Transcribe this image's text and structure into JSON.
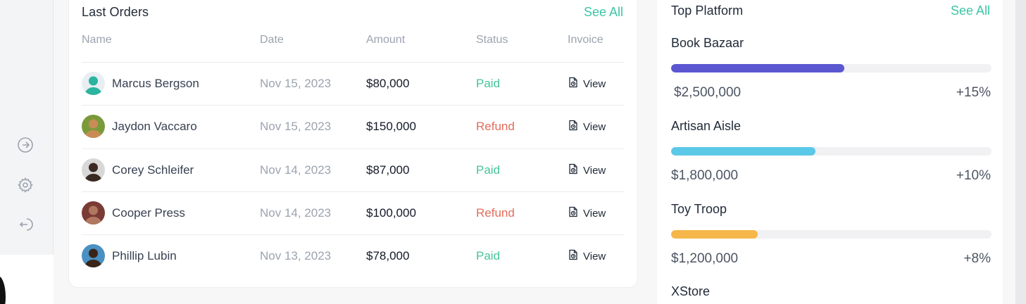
{
  "sidebar": {
    "icons": [
      {
        "name": "arrow-right-circle-icon"
      },
      {
        "name": "gear-icon"
      },
      {
        "name": "logout-icon"
      }
    ]
  },
  "orders": {
    "title": "Last Orders",
    "see_all": "See All",
    "columns": [
      "Name",
      "Date",
      "Amount",
      "Status",
      "Invoice"
    ],
    "rows": [
      {
        "name": "Marcus Bergson",
        "date": "Nov 15, 2023",
        "amount": "$80,000",
        "status": "Paid",
        "invoice": "View",
        "avatar_bg": "#e8eef2",
        "avatar_fg": "#2bb4a0"
      },
      {
        "name": "Jaydon Vaccaro",
        "date": "Nov 15, 2023",
        "amount": "$150,000",
        "status": "Refund",
        "invoice": "View",
        "avatar_bg": "#7a9a3a",
        "avatar_fg": "#c98c55"
      },
      {
        "name": "Corey Schleifer",
        "date": "Nov 14, 2023",
        "amount": "$87,000",
        "status": "Paid",
        "invoice": "View",
        "avatar_bg": "#d8d8d8",
        "avatar_fg": "#3a2a22"
      },
      {
        "name": "Cooper Press",
        "date": "Nov 14, 2023",
        "amount": "$100,000",
        "status": "Refund",
        "invoice": "View",
        "avatar_bg": "#7a3b34",
        "avatar_fg": "#b07860"
      },
      {
        "name": "Phillip Lubin",
        "date": "Nov 13, 2023",
        "amount": "$78,000",
        "status": "Paid",
        "invoice": "View",
        "avatar_bg": "#4a90c2",
        "avatar_fg": "#3a2418"
      }
    ]
  },
  "platform": {
    "title": "Top Platform",
    "see_all": "See All",
    "items": [
      {
        "name": "Book Bazaar",
        "value": "$2,500,000",
        "change": "+15%",
        "progress": 0.54,
        "color": "#5b57d1"
      },
      {
        "name": "Artisan Aisle",
        "value": "$1,800,000",
        "change": "+10%",
        "progress": 0.45,
        "color": "#5bc8e8"
      },
      {
        "name": "Toy Troop",
        "value": "$1,200,000",
        "change": "+8%",
        "progress": 0.27,
        "color": "#f5b74a"
      },
      {
        "name": "XStore"
      }
    ]
  },
  "colors": {
    "accent": "#3cc6a7",
    "paid": "#45c49b",
    "refund": "#e26d5c"
  }
}
